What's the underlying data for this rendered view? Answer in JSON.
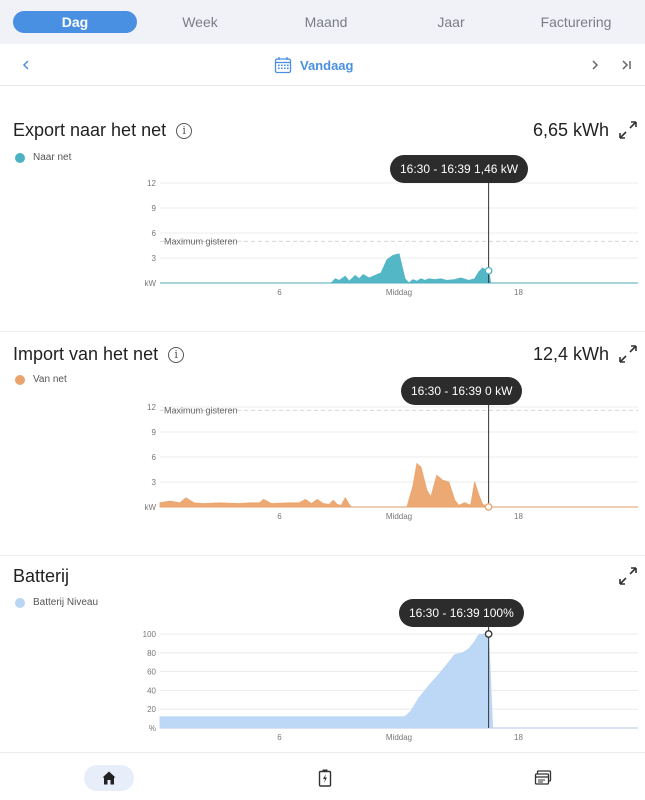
{
  "tabs": [
    {
      "label": "Dag",
      "active": true
    },
    {
      "label": "Week",
      "active": false
    },
    {
      "label": "Maand",
      "active": false
    },
    {
      "label": "Jaar",
      "active": false
    },
    {
      "label": "Facturering",
      "active": false
    }
  ],
  "datebar": {
    "label": "Vandaag"
  },
  "export": {
    "title": "Export naar het net",
    "value": "6,65 kWh",
    "legend": "Naar net",
    "color": "#4bb3c3",
    "tooltip": "16:30 - 16:39 1,46 kW",
    "max_label": "Maximum gisteren"
  },
  "import": {
    "title": "Import van het net",
    "value": "12,4 kWh",
    "legend": "Van net",
    "color": "#eba46d",
    "tooltip": "16:30 - 16:39 0 kW",
    "max_label": "Maximum gisteren"
  },
  "battery": {
    "title": "Batterij",
    "legend": "Batterij Niveau",
    "color": "#b9d6f5",
    "tooltip": "16:30 - 16:39 100%"
  },
  "chart_data": [
    {
      "type": "area",
      "name": "export",
      "yticks": [
        "kW",
        "3",
        "6",
        "9",
        "12"
      ],
      "ylim": [
        0,
        12
      ],
      "xticks": [
        "6",
        "Middag",
        "18"
      ],
      "xlim": [
        0,
        24
      ],
      "max_yesterday": 5,
      "cursor_x": 16.5,
      "series": [
        {
          "name": "Naar net",
          "x": [
            0,
            8.6,
            8.8,
            9.0,
            9.3,
            9.5,
            9.8,
            10.0,
            10.2,
            10.5,
            10.8,
            11.1,
            11.4,
            11.7,
            12.0,
            12.3,
            12.5,
            12.7,
            12.9,
            13.1,
            13.3,
            13.5,
            13.8,
            14.1,
            14.4,
            14.8,
            15.1,
            15.5,
            15.8,
            16.0,
            16.2,
            16.4,
            16.5,
            16.6,
            24
          ],
          "y": [
            0,
            0,
            0.5,
            0.3,
            0.8,
            0.2,
            0.9,
            0.5,
            1.0,
            0.6,
            0.9,
            1.2,
            2.8,
            3.3,
            3.5,
            0.5,
            0,
            0.4,
            0.2,
            0.5,
            0.3,
            0.5,
            0.4,
            0.5,
            0.3,
            0.4,
            0.6,
            0.3,
            0.5,
            1.3,
            1.8,
            1.5,
            1.46,
            0,
            0
          ]
        }
      ]
    },
    {
      "type": "area",
      "name": "import",
      "yticks": [
        "kW",
        "3",
        "6",
        "9",
        "12"
      ],
      "ylim": [
        0,
        12
      ],
      "xticks": [
        "6",
        "Middag",
        "18"
      ],
      "xlim": [
        0,
        24
      ],
      "max_yesterday": 11.6,
      "cursor_x": 16.5,
      "series": [
        {
          "name": "Van net",
          "x": [
            0,
            0.5,
            1.0,
            1.3,
            1.7,
            2.2,
            3.0,
            4.0,
            4.5,
            5.0,
            5.2,
            5.6,
            6.5,
            7.0,
            7.3,
            7.6,
            7.9,
            8.2,
            8.5,
            8.7,
            8.9,
            9.1,
            9.3,
            9.5,
            9.6,
            12.4,
            12.7,
            12.9,
            13.1,
            13.4,
            13.6,
            13.9,
            14.2,
            14.5,
            14.8,
            15.0,
            15.3,
            15.6,
            15.8,
            16.0,
            16.2,
            16.5,
            24
          ],
          "y": [
            0.5,
            0.7,
            0.5,
            1.1,
            0.5,
            0.4,
            0.5,
            0.4,
            0.5,
            0.5,
            0.9,
            0.4,
            0.5,
            0.5,
            0.9,
            0.4,
            0.9,
            0.4,
            0.3,
            0.8,
            0.3,
            0.2,
            1.1,
            0.3,
            0,
            0,
            2.5,
            5.2,
            4.8,
            2.0,
            1.2,
            3.8,
            3.2,
            3.0,
            0.8,
            0.2,
            0.5,
            0.2,
            3.0,
            1.5,
            0.3,
            0,
            0
          ]
        }
      ]
    },
    {
      "type": "area",
      "name": "battery",
      "yticks": [
        "%",
        "20",
        "40",
        "60",
        "80",
        "100"
      ],
      "ylim": [
        0,
        100
      ],
      "xticks": [
        "6",
        "Middag",
        "18"
      ],
      "xlim": [
        0,
        24
      ],
      "cursor_x": 16.5,
      "series": [
        {
          "name": "Batterij Niveau",
          "x": [
            0,
            12.3,
            12.6,
            13.0,
            13.5,
            14.0,
            14.5,
            14.8,
            15.2,
            15.5,
            15.8,
            16.0,
            16.2,
            16.5,
            16.7,
            24
          ],
          "y": [
            12,
            12,
            18,
            32,
            45,
            57,
            70,
            78,
            80,
            84,
            92,
            99,
            100,
            100,
            0,
            0
          ]
        }
      ]
    }
  ]
}
